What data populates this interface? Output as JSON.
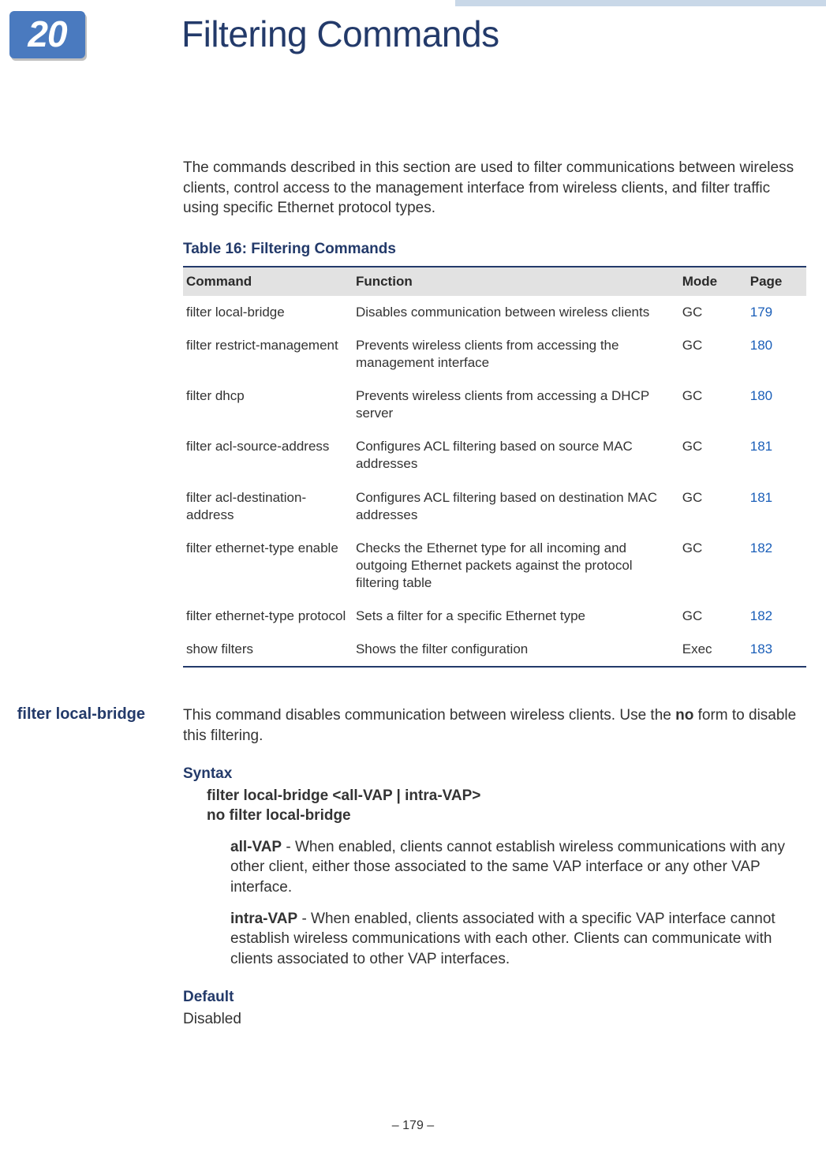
{
  "chapter": {
    "number": "20",
    "title": "Filtering Commands"
  },
  "intro": "The commands described in this section are used to filter communications between wireless clients, control access to the management interface from wireless clients, and filter traffic using specific Ethernet protocol types.",
  "table": {
    "title": "Table 16: Filtering Commands",
    "headers": {
      "command": "Command",
      "function": "Function",
      "mode": "Mode",
      "page": "Page"
    },
    "rows": [
      {
        "command": "filter local-bridge",
        "function": "Disables communication between wireless clients",
        "mode": "GC",
        "page": "179"
      },
      {
        "command": "filter restrict-management",
        "function": "Prevents wireless clients from accessing the management interface",
        "mode": "GC",
        "page": "180"
      },
      {
        "command": "filter dhcp",
        "function": "Prevents wireless clients from accessing a DHCP server",
        "mode": "GC",
        "page": "180"
      },
      {
        "command": "filter acl-source-address",
        "function": "Configures ACL filtering based on source MAC addresses",
        "mode": "GC",
        "page": "181"
      },
      {
        "command": "filter acl-destination-address",
        "function": "Configures ACL filtering based on destination MAC addresses",
        "mode": "GC",
        "page": "181"
      },
      {
        "command": "filter ethernet-type enable",
        "function": "Checks the Ethernet type for all incoming and outgoing Ethernet packets against the protocol filtering table",
        "mode": "GC",
        "page": "182"
      },
      {
        "command": "filter ethernet-type protocol",
        "function": "Sets a filter for a specific Ethernet type",
        "mode": "GC",
        "page": "182"
      },
      {
        "command": "show filters",
        "function": "Shows the filter configuration",
        "mode": "Exec",
        "page": "183"
      }
    ]
  },
  "command_detail": {
    "name": "filter local-bridge",
    "desc_pre": "This command disables communication between wireless clients. Use the ",
    "desc_bold": "no",
    "desc_post": " form to disable this filtering.",
    "syntax_heading": "Syntax",
    "syntax_line1": "filter local-bridge <all-VAP | intra-VAP>",
    "syntax_line2": "no filter local-bridge",
    "param1_name": "all-VAP",
    "param1_desc": " - When enabled, clients cannot establish wireless communications with any other client, either those associated to the same VAP interface or any other VAP interface.",
    "param2_name": "intra-VAP",
    "param2_desc": " - When enabled, clients associated with a specific VAP interface cannot establish wireless communications with each other. Clients can communicate with clients associated to other VAP interfaces.",
    "default_heading": "Default",
    "default_value": "Disabled"
  },
  "footer": "–  179  –"
}
